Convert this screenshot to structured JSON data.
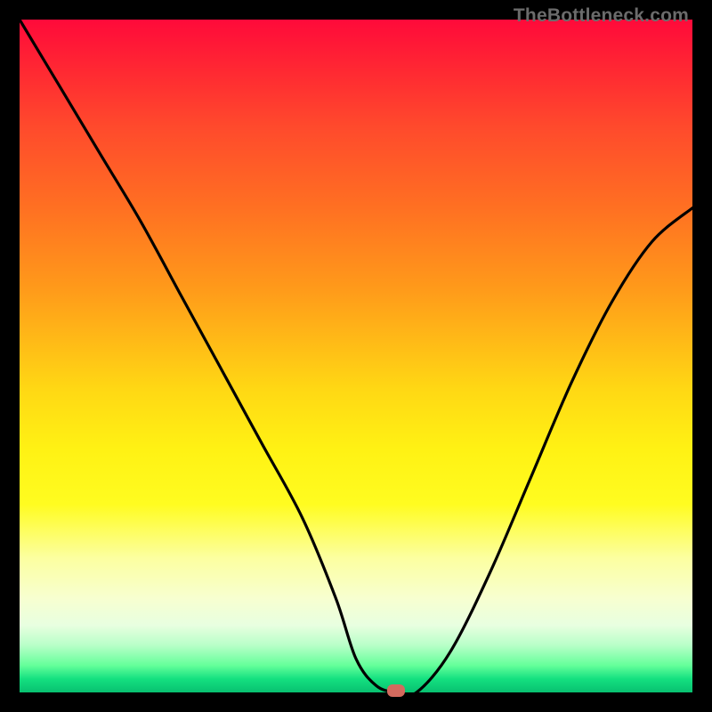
{
  "watermark": "TheBottleneck.com",
  "chart_data": {
    "type": "line",
    "title": "",
    "xlabel": "",
    "ylabel": "",
    "xlim": [
      0,
      100
    ],
    "ylim": [
      0,
      100
    ],
    "background_gradient": "top red → yellow → green bottom, value near 0 is optimal (green), higher is worse (red)",
    "series": [
      {
        "name": "bottleneck-curve",
        "x": [
          0,
          6,
          12,
          18,
          24,
          30,
          36,
          42,
          47,
          50,
          53,
          56,
          59,
          64,
          70,
          76,
          82,
          88,
          94,
          100
        ],
        "values": [
          100,
          90,
          80,
          70,
          59,
          48,
          37,
          26,
          14,
          5,
          1,
          0,
          0,
          6,
          18,
          32,
          46,
          58,
          67,
          72
        ]
      }
    ],
    "marker": {
      "x": 56,
      "y": 0,
      "label": "optimal-point"
    },
    "gradient_stops": [
      {
        "pos": 0,
        "color": "#ff0a3a"
      },
      {
        "pos": 16,
        "color": "#ff4a2c"
      },
      {
        "pos": 40,
        "color": "#ff9a1a"
      },
      {
        "pos": 64,
        "color": "#fff214"
      },
      {
        "pos": 86,
        "color": "#f7ffd0"
      },
      {
        "pos": 96,
        "color": "#64ff9a"
      },
      {
        "pos": 100,
        "color": "#08c070"
      }
    ]
  }
}
